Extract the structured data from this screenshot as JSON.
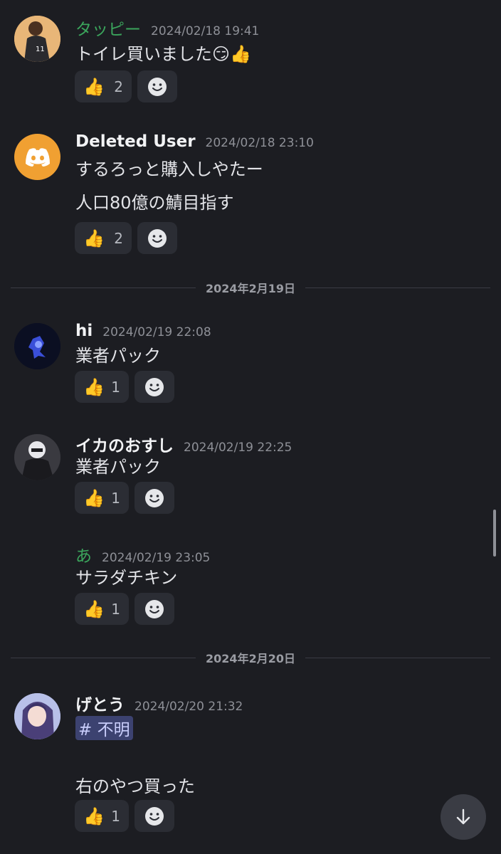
{
  "messages": [
    {
      "author": "タッピー",
      "timestamp": "2024/02/18 19:41",
      "lines": [
        "トイレ買いました😏👍"
      ],
      "reaction_count": "2"
    },
    {
      "author": "Deleted User",
      "timestamp": "2024/02/18 23:10",
      "lines": [
        "するろっと購入しやたー",
        "人口80億の鯖目指す"
      ],
      "reaction_count": "2"
    },
    {
      "author": "hi",
      "timestamp": "2024/02/19 22:08",
      "lines": [
        "業者パック"
      ],
      "reaction_count": "1"
    },
    {
      "author": "イカのおすし",
      "timestamp": "2024/02/19 22:25",
      "lines": [
        "業者パック"
      ],
      "reaction_count": "1"
    },
    {
      "author": "あ",
      "timestamp": "2024/02/19 23:05",
      "lines": [
        "サラダチキン"
      ],
      "reaction_count": "1"
    },
    {
      "author": "げとう",
      "timestamp": "2024/02/20 21:32",
      "channel_mention": "# 不明",
      "lines": [
        "右のやつ買った"
      ],
      "reaction_count": "1"
    }
  ],
  "date_dividers": [
    "2024年2月19日",
    "2024年2月20日"
  ],
  "reaction_emoji": "👍",
  "add_reaction_icon": "smile-face-icon",
  "scroll_button_icon": "arrow-down-icon",
  "colors": {
    "background": "#1c1d22",
    "green_name": "#3ba55c",
    "discord_orange": "#f0a032",
    "mention_bg": "#3c4270"
  }
}
